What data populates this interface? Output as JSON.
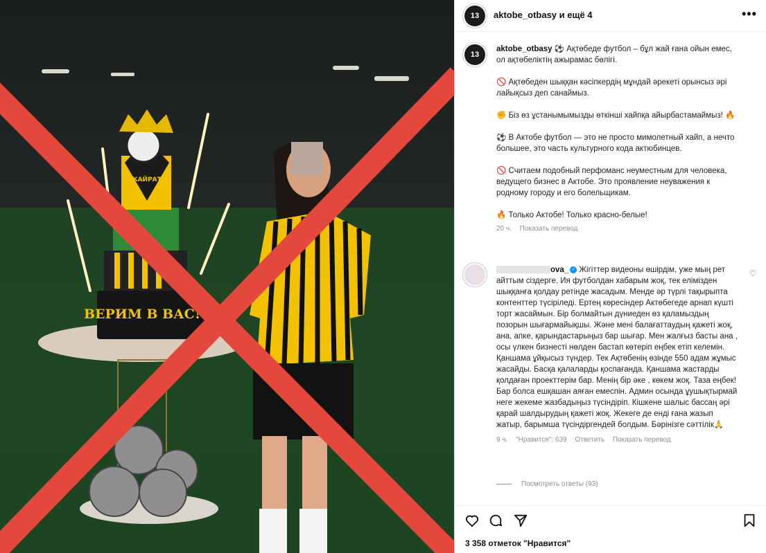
{
  "header": {
    "title": "aktobe_otbasy и ещё 4",
    "avatar_label": "13",
    "more_label": "•••"
  },
  "media": {
    "cake_banner": "ВЕРИМ В ВАС!",
    "cake_logo": "КАЙРАТ"
  },
  "caption": {
    "username": "aktobe_otbasy",
    "paragraphs": [
      "⚽ Ақтөбеде футбол – бұл жай ғана ойын емес, ол ақтөбеліктің ажырамас бөлігі.",
      "🚫 Ақтөбеден шыққан кәсіпкердің мұндай әрекеті орынсыз әрі лайықсыз деп санаймыз.",
      "✊ Біз өз ұстанымымызды өткінші хайпқа айырбастамаймыз! 🔥",
      "⚽ В Актобе футбол — это не просто мимолетный хайп, а нечто большее, это часть культурного кода актюбинцев.",
      "🚫 Считаем подобный перфоманс неуместным для человека, ведущего бизнес в Актобе. Это проявление неуважения к родному городу и его болельщикам.",
      "🔥 Только Актобе! Только красно-белые!"
    ],
    "time": "20 ч.",
    "translate": "Показать перевод"
  },
  "comment": {
    "username_suffix": "ova_",
    "text": "Жігіттер видеоны өшірдім, уже мың рет айттым сіздерге. Ия футболдан хабарым жоқ, тек елімізден шыққанға қолдау ретінде жасадым. Менде әр түрлі тақырыпта контенттер түсіріледі. Ертең көресіндер Актөбегеде арнап күшті торт жасаймын. Бір болмайтын дүниеден өз қаламыздың позорын шығармайықшы. Және мені балағаттаудың қажеті жоқ, ана, апке, қарындастарыңыз бар шығар. Мен жалғыз басты ана , осы үлкен бизнесті нөлден бастап көтеріп еңбек етіп келемін. Қаншама ұйқысыз түндер. Тек Ақтөбенің өзінде 550 адам жұмыс жасайды. Басқа қалаларды қоспағанда. Қаншама жастарды қолдаған проекттерім бар. Менің бір әке , көкем жоқ. Таза еңбек! Бар болса ешқашан аяған емеспін. Админ осында ұушықтырмай неге жекеме жазбадыңыз түсіндіріп. Кішкене шалыс бассаң әрі қарай шалдырудың қажеті жоқ. Жекеге де енді ғана жазып жатыр, барымша түсіндіргендей болдым. Бәрінізге сәттілік🙏",
    "time": "9 ч.",
    "likes": "\"Нравится\": 639",
    "reply": "Ответить",
    "translate": "Показать перевод",
    "view_replies": "Посмотреть ответы (93)"
  },
  "footer": {
    "likes_count": "3 358 отметок \"Нравится\""
  },
  "colors": {
    "cross": "#e4473c",
    "jersey_yellow": "#f2c200",
    "link_blue": "#0095f6"
  }
}
